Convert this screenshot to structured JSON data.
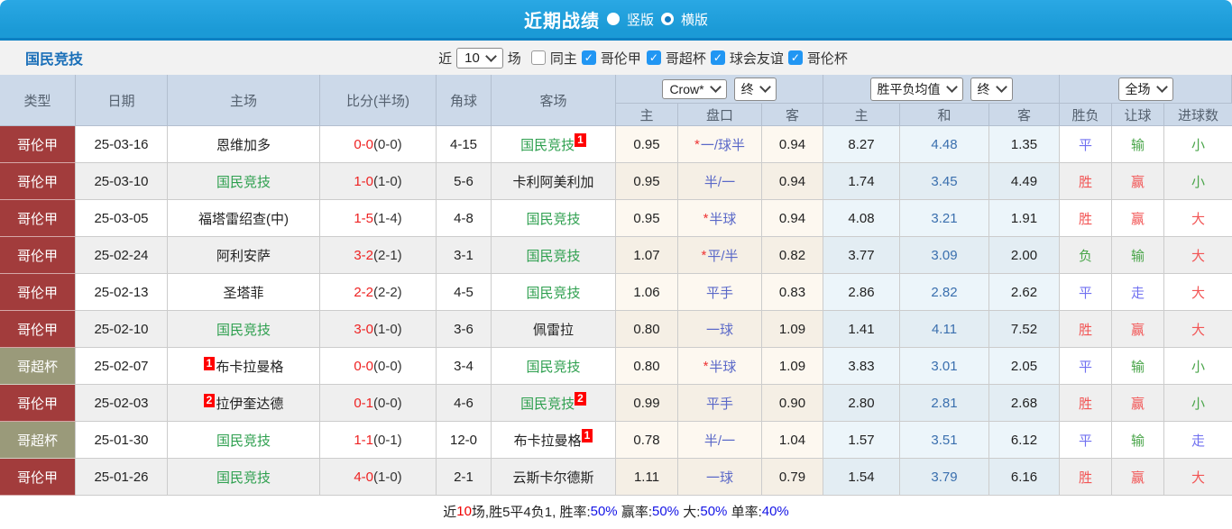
{
  "title_bar": {
    "title": "近期战绩",
    "radios": [
      {
        "label": "竖版",
        "checked": false
      },
      {
        "label": "横版",
        "checked": true
      }
    ]
  },
  "filter": {
    "team": "国民竞技",
    "near_label": "近",
    "near_value": "10",
    "games_label": "场",
    "same_home_label": "同主",
    "same_home_checked": false,
    "leagues": [
      {
        "label": "哥伦甲",
        "checked": true
      },
      {
        "label": "哥超杯",
        "checked": true
      },
      {
        "label": "球会友谊",
        "checked": true
      },
      {
        "label": "哥伦杯",
        "checked": true
      }
    ]
  },
  "header": {
    "static_cols": [
      "类型",
      "日期",
      "主场",
      "比分(半场)",
      "角球",
      "客场"
    ],
    "odds_group": {
      "bookmaker_select": "Crow*",
      "time_select": "终",
      "cols": [
        "主",
        "盘口",
        "客"
      ]
    },
    "avg_group": {
      "metric_select": "胜平负均值",
      "time_select": "终",
      "cols": [
        "主",
        "和",
        "客"
      ]
    },
    "result_group": {
      "scope_select": "全场",
      "cols": [
        "胜负",
        "让球",
        "进球数"
      ]
    }
  },
  "rows": [
    {
      "league": "哥伦甲",
      "league_color": "red",
      "date": "25-03-16",
      "home": {
        "name": "恩维加多",
        "green": false
      },
      "score_ft": "0-0",
      "score_ht": "(0-0)",
      "corner": "4-15",
      "away": {
        "name": "国民竞技",
        "green": true,
        "sup_after": "1"
      },
      "odds_home": "0.95",
      "handicap_star": true,
      "handicap": "一/球半",
      "odds_away": "0.94",
      "avg_home": "8.27",
      "avg_draw": "4.48",
      "avg_away": "1.35",
      "result_wdl": {
        "text": "平",
        "color": "blue"
      },
      "result_handicap": {
        "text": "输",
        "color": "green"
      },
      "result_goals": {
        "text": "小",
        "color": "green"
      }
    },
    {
      "league": "哥伦甲",
      "league_color": "red",
      "date": "25-03-10",
      "home": {
        "name": "国民竞技",
        "green": true
      },
      "score_ft": "1-0",
      "score_ht": "(1-0)",
      "corner": "5-6",
      "away": {
        "name": "卡利阿美利加",
        "green": false
      },
      "odds_home": "0.95",
      "handicap_star": false,
      "handicap": "半/一",
      "odds_away": "0.94",
      "avg_home": "1.74",
      "avg_draw": "3.45",
      "avg_away": "4.49",
      "result_wdl": {
        "text": "胜",
        "color": "red"
      },
      "result_handicap": {
        "text": "赢",
        "color": "red"
      },
      "result_goals": {
        "text": "小",
        "color": "green"
      }
    },
    {
      "league": "哥伦甲",
      "league_color": "red",
      "date": "25-03-05",
      "home": {
        "name": "福塔雷绍查(中)",
        "green": false
      },
      "score_ft": "1-5",
      "score_ht": "(1-4)",
      "corner": "4-8",
      "away": {
        "name": "国民竞技",
        "green": true
      },
      "odds_home": "0.95",
      "handicap_star": true,
      "handicap": "半球",
      "odds_away": "0.94",
      "avg_home": "4.08",
      "avg_draw": "3.21",
      "avg_away": "1.91",
      "result_wdl": {
        "text": "胜",
        "color": "red"
      },
      "result_handicap": {
        "text": "赢",
        "color": "red"
      },
      "result_goals": {
        "text": "大",
        "color": "red"
      }
    },
    {
      "league": "哥伦甲",
      "league_color": "red",
      "date": "25-02-24",
      "home": {
        "name": "阿利安萨",
        "green": false
      },
      "score_ft": "3-2",
      "score_ht": "(2-1)",
      "corner": "3-1",
      "away": {
        "name": "国民竞技",
        "green": true
      },
      "odds_home": "1.07",
      "handicap_star": true,
      "handicap": "平/半",
      "odds_away": "0.82",
      "avg_home": "3.77",
      "avg_draw": "3.09",
      "avg_away": "2.00",
      "result_wdl": {
        "text": "负",
        "color": "green"
      },
      "result_handicap": {
        "text": "输",
        "color": "green"
      },
      "result_goals": {
        "text": "大",
        "color": "red"
      }
    },
    {
      "league": "哥伦甲",
      "league_color": "red",
      "date": "25-02-13",
      "home": {
        "name": "圣塔菲",
        "green": false
      },
      "score_ft": "2-2",
      "score_ht": "(2-2)",
      "corner": "4-5",
      "away": {
        "name": "国民竞技",
        "green": true
      },
      "odds_home": "1.06",
      "handicap_star": false,
      "handicap": "平手",
      "odds_away": "0.83",
      "avg_home": "2.86",
      "avg_draw": "2.82",
      "avg_away": "2.62",
      "result_wdl": {
        "text": "平",
        "color": "blue"
      },
      "result_handicap": {
        "text": "走",
        "color": "blue"
      },
      "result_goals": {
        "text": "大",
        "color": "red"
      }
    },
    {
      "league": "哥伦甲",
      "league_color": "red",
      "date": "25-02-10",
      "home": {
        "name": "国民竞技",
        "green": true
      },
      "score_ft": "3-0",
      "score_ht": "(1-0)",
      "corner": "3-6",
      "away": {
        "name": "佩雷拉",
        "green": false
      },
      "odds_home": "0.80",
      "handicap_star": false,
      "handicap": "一球",
      "odds_away": "1.09",
      "avg_home": "1.41",
      "avg_draw": "4.11",
      "avg_away": "7.52",
      "result_wdl": {
        "text": "胜",
        "color": "red"
      },
      "result_handicap": {
        "text": "赢",
        "color": "red"
      },
      "result_goals": {
        "text": "大",
        "color": "red"
      }
    },
    {
      "league": "哥超杯",
      "league_color": "olive",
      "date": "25-02-07",
      "home": {
        "name": "布卡拉曼格",
        "green": false,
        "sup_before": "1"
      },
      "score_ft": "0-0",
      "score_ht": "(0-0)",
      "corner": "3-4",
      "away": {
        "name": "国民竞技",
        "green": true
      },
      "odds_home": "0.80",
      "handicap_star": true,
      "handicap": "半球",
      "odds_away": "1.09",
      "avg_home": "3.83",
      "avg_draw": "3.01",
      "avg_away": "2.05",
      "result_wdl": {
        "text": "平",
        "color": "blue"
      },
      "result_handicap": {
        "text": "输",
        "color": "green"
      },
      "result_goals": {
        "text": "小",
        "color": "green"
      }
    },
    {
      "league": "哥伦甲",
      "league_color": "red",
      "date": "25-02-03",
      "home": {
        "name": "拉伊奎达德",
        "green": false,
        "sup_before": "2"
      },
      "score_ft": "0-1",
      "score_ht": "(0-0)",
      "corner": "4-6",
      "away": {
        "name": "国民竞技",
        "green": true,
        "sup_after": "2"
      },
      "odds_home": "0.99",
      "handicap_star": false,
      "handicap": "平手",
      "odds_away": "0.90",
      "avg_home": "2.80",
      "avg_draw": "2.81",
      "avg_away": "2.68",
      "result_wdl": {
        "text": "胜",
        "color": "red"
      },
      "result_handicap": {
        "text": "赢",
        "color": "red"
      },
      "result_goals": {
        "text": "小",
        "color": "green"
      }
    },
    {
      "league": "哥超杯",
      "league_color": "olive",
      "date": "25-01-30",
      "home": {
        "name": "国民竞技",
        "green": true
      },
      "score_ft": "1-1",
      "score_ht": "(0-1)",
      "corner": "12-0",
      "away": {
        "name": "布卡拉曼格",
        "green": false,
        "sup_after": "1"
      },
      "odds_home": "0.78",
      "handicap_star": false,
      "handicap": "半/一",
      "odds_away": "1.04",
      "avg_home": "1.57",
      "avg_draw": "3.51",
      "avg_away": "6.12",
      "result_wdl": {
        "text": "平",
        "color": "blue"
      },
      "result_handicap": {
        "text": "输",
        "color": "green"
      },
      "result_goals": {
        "text": "走",
        "color": "blue"
      }
    },
    {
      "league": "哥伦甲",
      "league_color": "red",
      "date": "25-01-26",
      "home": {
        "name": "国民竞技",
        "green": true
      },
      "score_ft": "4-0",
      "score_ht": "(1-0)",
      "corner": "2-1",
      "away": {
        "name": "云斯卡尔德斯",
        "green": false
      },
      "odds_home": "1.11",
      "handicap_star": false,
      "handicap": "一球",
      "odds_away": "0.79",
      "avg_home": "1.54",
      "avg_draw": "3.79",
      "avg_away": "6.16",
      "result_wdl": {
        "text": "胜",
        "color": "red"
      },
      "result_handicap": {
        "text": "赢",
        "color": "red"
      },
      "result_goals": {
        "text": "大",
        "color": "red"
      }
    }
  ],
  "summary": {
    "segments": [
      {
        "text": "近",
        "color": "black"
      },
      {
        "text": "10",
        "color": "red"
      },
      {
        "text": "场,胜5平4负1, 胜率:",
        "color": "black"
      },
      {
        "text": "50%",
        "color": "blue"
      },
      {
        "text": " 赢率:",
        "color": "black"
      },
      {
        "text": "50%",
        "color": "blue"
      },
      {
        "text": " 大:",
        "color": "black"
      },
      {
        "text": "50%",
        "color": "blue"
      },
      {
        "text": " 单率:",
        "color": "black"
      },
      {
        "text": "40%",
        "color": "blue"
      }
    ]
  },
  "colors": {
    "titlebar_blue": "#1b9ad6",
    "titlebar_dark_strip": "#0d80c3",
    "league_red": "#a23c3c",
    "league_olive": "#9a9a7a",
    "header_bg": "#ccd9e9",
    "row_alt_bg": "#efefef",
    "odds_col_bg": "#fdf8f0",
    "avg_col_bg": "#ecf5fa",
    "score_red": "#ee2222",
    "team_green": "#2d9f4e",
    "handicap_blue": "#5a68c8",
    "avg_draw_blue": "#3a6fae",
    "win_red": "#f25555",
    "draw_blue": "#7070f0",
    "lose_green": "#4aa54a",
    "checkbox_blue": "#2196f3",
    "team_link_blue": "#1a6fb8",
    "summary_value_blue": "#1414e6",
    "sup_badge_red": "#ff0000"
  }
}
